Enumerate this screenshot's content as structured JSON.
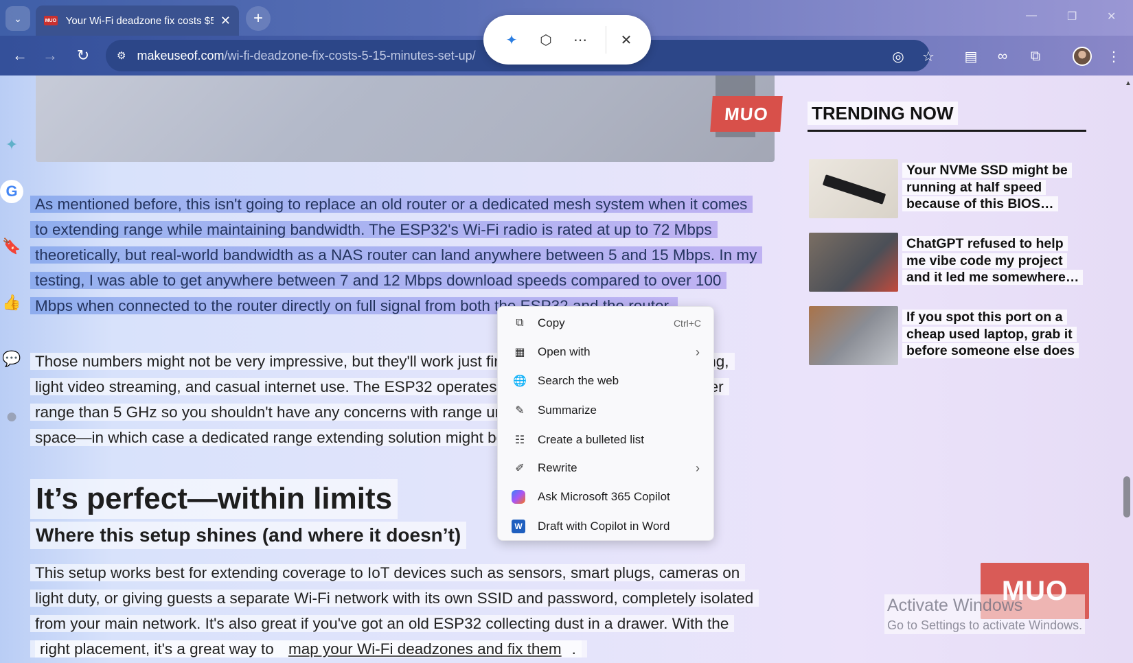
{
  "browser": {
    "tab": {
      "favicon": "MUO",
      "title": "Your Wi-Fi deadzone fix costs $5",
      "close": "✕"
    },
    "new_tab": "+",
    "url_host": "makeuseof.com",
    "url_path": "/wi-fi-deadzone-fix-costs-5-15-minutes-set-up/"
  },
  "article": {
    "hero_logo": "MUO",
    "selected_lines": [
      "As mentioned before, this isn't going to replace an old router or a dedicated mesh system when it comes",
      "to extending range while maintaining bandwidth. The ESP32's Wi-Fi radio is rated at up to 72 Mbps",
      "theoretically, but real-world bandwidth as a NAS router can land anywhere between 5 and 15 Mbps. In my",
      "testing, I was able to get anywhere between 7 and 12 Mbps download speeds compared to over 100",
      "Mbps when connected to the router directly on full signal from both the ESP32 and the router."
    ],
    "para2_lines": [
      "Those numbers might not be very impressive, but they'll work just fine for most IoT devices, browsing,",
      "light video streaming, and casual internet use. The ESP32 operates on 2.4 GHz, which gives it better",
      "range than 5 GHz so you shouldn't have any concerns with range unless you're covering a large",
      "space—in which case a dedicated range extending solution might be a better fit."
    ],
    "heading": "It’s perfect—within limits",
    "subheading": "Where this setup shines (and where it doesn’t)",
    "para3_lines": [
      "This setup works best for extending coverage to IoT devices such as sensors, smart plugs, cameras on",
      "light duty, or giving guests a separate Wi-Fi network with its own SSID and password, completely isolated",
      "from your main network. It's also great if you've got an old ESP32 collecting dust in a drawer. With the"
    ],
    "para3_last_prefix": "right placement, it's a great way to ",
    "para3_last_link": "map your Wi-Fi deadzones and fix them",
    "para3_last_suffix": "."
  },
  "trending": {
    "heading": "TRENDING NOW",
    "items": [
      {
        "title": "Your NVMe SSD might be running at half speed because of this BIOS…"
      },
      {
        "title": "ChatGPT refused to help me vibe code my project and it led me somewhere…"
      },
      {
        "title": "If you spot this port on a cheap used laptop, grab it before someone else does"
      }
    ]
  },
  "context_menu": {
    "items": [
      {
        "label": "Copy",
        "shortcut": "Ctrl+C",
        "icon": "copy-icon"
      },
      {
        "label": "Open with",
        "icon": "open-with-icon",
        "submenu": true
      },
      {
        "label": "Search the web",
        "icon": "globe-icon"
      },
      {
        "label": "Summarize",
        "icon": "summarize-icon"
      },
      {
        "label": "Create a bulleted list",
        "icon": "bulleted-list-icon"
      },
      {
        "label": "Rewrite",
        "icon": "rewrite-icon",
        "submenu": true
      },
      {
        "label": "Ask Microsoft 365 Copilot",
        "icon": "m365-copilot-icon"
      },
      {
        "label": "Draft with Copilot in Word",
        "icon": "word-icon"
      }
    ]
  },
  "watermark": {
    "logo": "MUO",
    "line1": "Activate Windows",
    "line2": "Go to Settings to activate Windows."
  },
  "colors": {
    "selection": "#7a8fe6",
    "tabbar": "#4a62ad",
    "muo_red": "#d8504a"
  }
}
